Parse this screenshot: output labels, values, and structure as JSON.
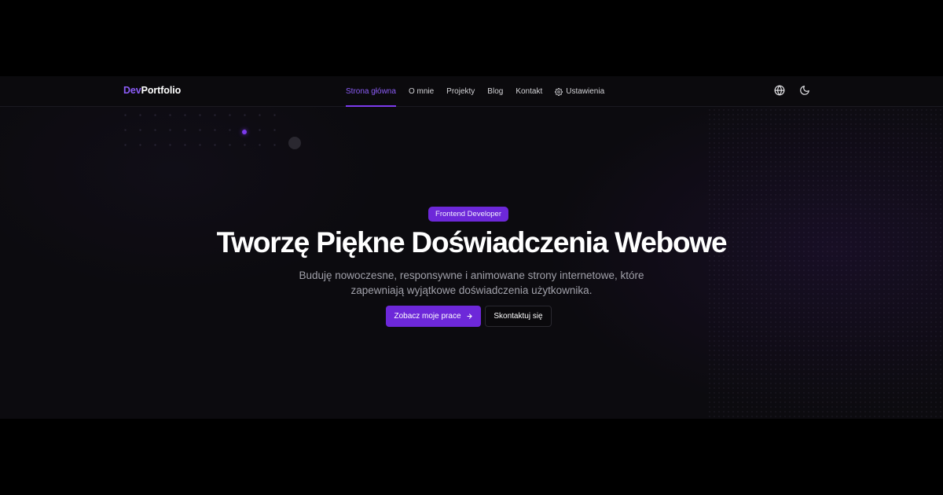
{
  "header": {
    "logo_accent": "Dev",
    "logo_main": "Portfolio",
    "nav": [
      {
        "label": "Strona główna",
        "active": true
      },
      {
        "label": "O mnie",
        "active": false
      },
      {
        "label": "Projekty",
        "active": false
      },
      {
        "label": "Blog",
        "active": false
      },
      {
        "label": "Kontakt",
        "active": false
      },
      {
        "label": "Ustawienia",
        "active": false,
        "icon": "gear-icon"
      }
    ],
    "actions": [
      {
        "icon": "globe-icon"
      },
      {
        "icon": "moon-icon"
      }
    ]
  },
  "hero": {
    "badge": "Frontend Developer",
    "title": "Tworzę Piękne Doświadczenia Webowe",
    "subtitle_line1": "Buduję nowoczesne, responsywne i animowane strony internetowe, które",
    "subtitle_line2": "zapewniają wyjątkowe doświadczenia użytkownika.",
    "primary_cta": "Zobacz moje prace",
    "primary_cta_icon": "arrow-right-icon",
    "secondary_cta": "Skontaktuj się"
  },
  "colors": {
    "accent": "#7c3aed",
    "accent_text": "#8b5cf6",
    "background": "#0c0b0f",
    "text": "#ffffff",
    "muted_text": "#a1a1aa"
  }
}
